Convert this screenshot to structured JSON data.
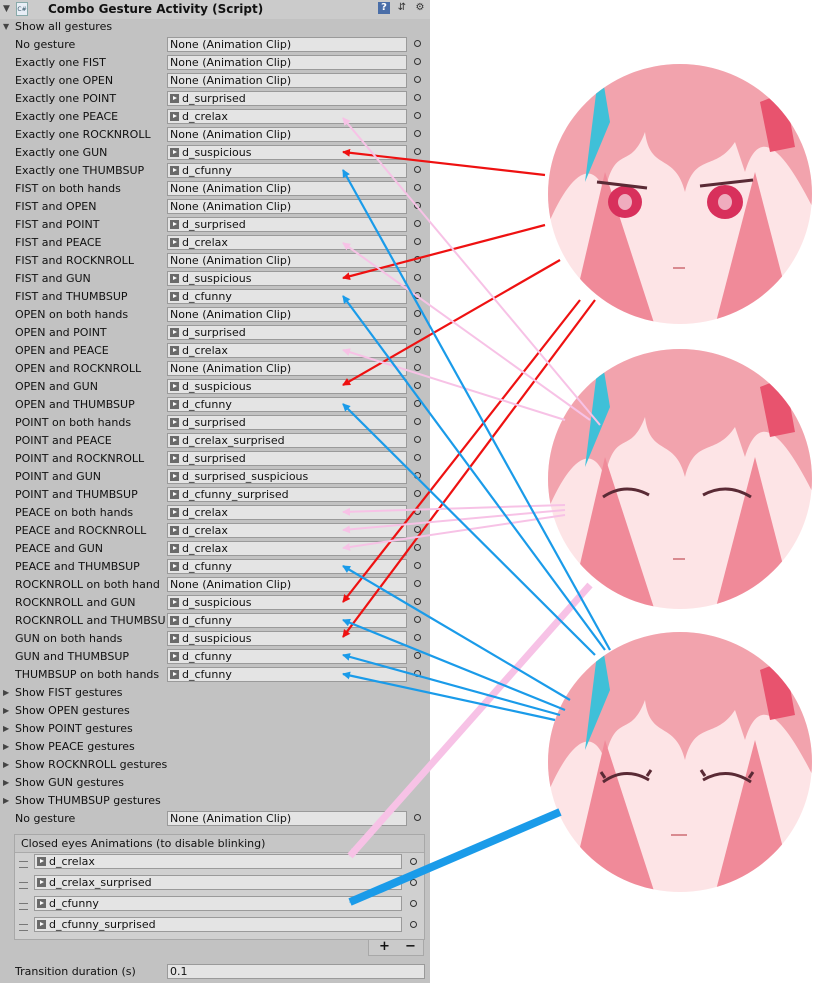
{
  "header": {
    "title": "Combo Gesture Activity (Script)",
    "help_icon": "help-book-icon",
    "preset_icon": "preset-icon",
    "settings_icon": "gear-icon"
  },
  "show_all": {
    "label": "Show all gestures"
  },
  "gestures": [
    {
      "label": "No gesture",
      "value": "None (Animation Clip)",
      "has_clip": false
    },
    {
      "label": "Exactly one FIST",
      "value": "None (Animation Clip)",
      "has_clip": false
    },
    {
      "label": "Exactly one OPEN",
      "value": "None (Animation Clip)",
      "has_clip": false
    },
    {
      "label": "Exactly one POINT",
      "value": "d_surprised",
      "has_clip": true
    },
    {
      "label": "Exactly one PEACE",
      "value": "d_crelax",
      "has_clip": true
    },
    {
      "label": "Exactly one ROCKNROLL",
      "value": "None (Animation Clip)",
      "has_clip": false
    },
    {
      "label": "Exactly one GUN",
      "value": "d_suspicious",
      "has_clip": true
    },
    {
      "label": "Exactly one THUMBSUP",
      "value": "d_cfunny",
      "has_clip": true
    },
    {
      "label": "FIST on both hands",
      "value": "None (Animation Clip)",
      "has_clip": false
    },
    {
      "label": "FIST and OPEN",
      "value": "None (Animation Clip)",
      "has_clip": false
    },
    {
      "label": "FIST and POINT",
      "value": "d_surprised",
      "has_clip": true
    },
    {
      "label": "FIST and PEACE",
      "value": "d_crelax",
      "has_clip": true
    },
    {
      "label": "FIST and ROCKNROLL",
      "value": "None (Animation Clip)",
      "has_clip": false
    },
    {
      "label": "FIST and GUN",
      "value": "d_suspicious",
      "has_clip": true
    },
    {
      "label": "FIST and THUMBSUP",
      "value": "d_cfunny",
      "has_clip": true
    },
    {
      "label": "OPEN on both hands",
      "value": "None (Animation Clip)",
      "has_clip": false
    },
    {
      "label": "OPEN and POINT",
      "value": "d_surprised",
      "has_clip": true
    },
    {
      "label": "OPEN and PEACE",
      "value": "d_crelax",
      "has_clip": true
    },
    {
      "label": "OPEN and ROCKNROLL",
      "value": "None (Animation Clip)",
      "has_clip": false
    },
    {
      "label": "OPEN and GUN",
      "value": "d_suspicious",
      "has_clip": true
    },
    {
      "label": "OPEN and THUMBSUP",
      "value": "d_cfunny",
      "has_clip": true
    },
    {
      "label": "POINT on both hands",
      "value": "d_surprised",
      "has_clip": true
    },
    {
      "label": "POINT and PEACE",
      "value": "d_crelax_surprised",
      "has_clip": true
    },
    {
      "label": "POINT and ROCKNROLL",
      "value": "d_surprised",
      "has_clip": true
    },
    {
      "label": "POINT and GUN",
      "value": "d_surprised_suspicious",
      "has_clip": true
    },
    {
      "label": "POINT and THUMBSUP",
      "value": "d_cfunny_surprised",
      "has_clip": true
    },
    {
      "label": "PEACE on both hands",
      "value": "d_crelax",
      "has_clip": true
    },
    {
      "label": "PEACE and ROCKNROLL",
      "value": "d_crelax",
      "has_clip": true
    },
    {
      "label": "PEACE and GUN",
      "value": "d_crelax",
      "has_clip": true
    },
    {
      "label": "PEACE and THUMBSUP",
      "value": "d_cfunny",
      "has_clip": true
    },
    {
      "label": "ROCKNROLL on both hand",
      "value": "None (Animation Clip)",
      "has_clip": false
    },
    {
      "label": "ROCKNROLL and GUN",
      "value": "d_suspicious",
      "has_clip": true
    },
    {
      "label": "ROCKNROLL and THUMBSU",
      "value": "d_cfunny",
      "has_clip": true
    },
    {
      "label": "GUN on both hands",
      "value": "d_suspicious",
      "has_clip": true
    },
    {
      "label": "GUN and THUMBSUP",
      "value": "d_cfunny",
      "has_clip": true
    },
    {
      "label": "THUMBSUP on both hands",
      "value": "d_cfunny",
      "has_clip": true
    }
  ],
  "foldouts": [
    {
      "label": "Show FIST gestures"
    },
    {
      "label": "Show OPEN gestures"
    },
    {
      "label": "Show POINT gestures"
    },
    {
      "label": "Show PEACE gestures"
    },
    {
      "label": "Show ROCKNROLL gestures"
    },
    {
      "label": "Show GUN gestures"
    },
    {
      "label": "Show THUMBSUP gestures"
    }
  ],
  "no_gesture_bottom": {
    "label": "No gesture",
    "value": "None (Animation Clip)"
  },
  "closed_eyes": {
    "header": "Closed eyes Animations (to disable blinking)",
    "items": [
      {
        "value": "d_crelax"
      },
      {
        "value": "d_crelax_surprised"
      },
      {
        "value": "d_cfunny"
      },
      {
        "value": "d_cfunny_surprised"
      }
    ],
    "add_label": "+",
    "remove_label": "−"
  },
  "transition": {
    "label": "Transition duration (s)",
    "value": "0.1"
  },
  "colors": {
    "panel_bg": "#c2c2c2",
    "arrow_suspicious": "#ee1111",
    "arrow_crelax": "#f7c2e6",
    "arrow_cfunny": "#1a9be9",
    "hair": "#f4a6b0",
    "hair_accent": "#3fc0d8",
    "eye": "#d8305c"
  },
  "avatars": [
    {
      "expression": "suspicious"
    },
    {
      "expression": "relaxed-closed-eyes"
    },
    {
      "expression": "funny-closed-eyes"
    }
  ]
}
